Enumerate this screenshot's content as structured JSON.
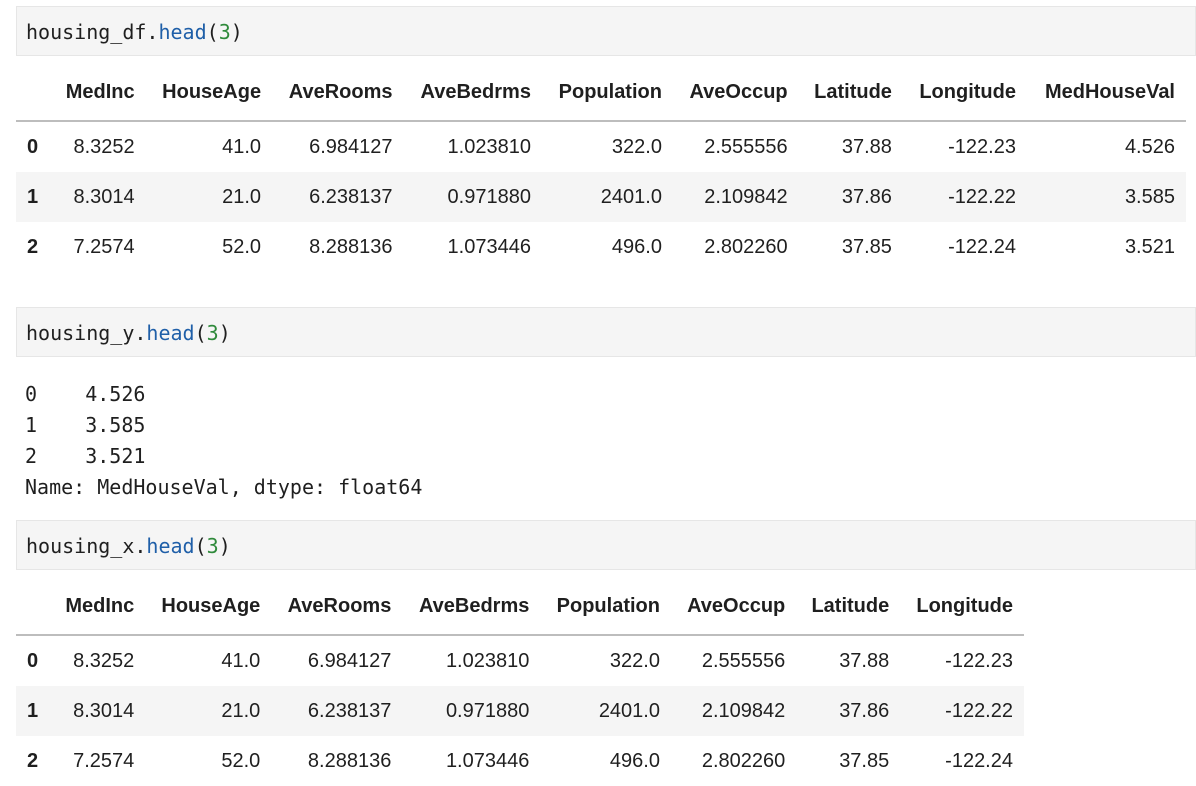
{
  "cells": [
    {
      "var": "housing_df",
      "dot": ".",
      "fn": "head",
      "open": "(",
      "arg": "3",
      "close": ")"
    },
    {
      "var": "housing_y",
      "dot": ".",
      "fn": "head",
      "open": "(",
      "arg": "3",
      "close": ")"
    },
    {
      "var": "housing_x",
      "dot": ".",
      "fn": "head",
      "open": "(",
      "arg": "3",
      "close": ")"
    }
  ],
  "df_table": {
    "columns": [
      "MedInc",
      "HouseAge",
      "AveRooms",
      "AveBedrms",
      "Population",
      "AveOccup",
      "Latitude",
      "Longitude",
      "MedHouseVal"
    ],
    "rows": [
      {
        "index": "0",
        "values": [
          "8.3252",
          "41.0",
          "6.984127",
          "1.023810",
          "322.0",
          "2.555556",
          "37.88",
          "-122.23",
          "4.526"
        ]
      },
      {
        "index": "1",
        "values": [
          "8.3014",
          "21.0",
          "6.238137",
          "0.971880",
          "2401.0",
          "2.109842",
          "37.86",
          "-122.22",
          "3.585"
        ]
      },
      {
        "index": "2",
        "values": [
          "7.2574",
          "52.0",
          "8.288136",
          "1.073446",
          "496.0",
          "2.802260",
          "37.85",
          "-122.24",
          "3.521"
        ]
      }
    ]
  },
  "y_output": {
    "lines": [
      "0    4.526",
      "1    3.585",
      "2    3.521",
      "Name: MedHouseVal, dtype: float64"
    ]
  },
  "x_table": {
    "columns": [
      "MedInc",
      "HouseAge",
      "AveRooms",
      "AveBedrms",
      "Population",
      "AveOccup",
      "Latitude",
      "Longitude"
    ],
    "rows": [
      {
        "index": "0",
        "values": [
          "8.3252",
          "41.0",
          "6.984127",
          "1.023810",
          "322.0",
          "2.555556",
          "37.88",
          "-122.23"
        ]
      },
      {
        "index": "1",
        "values": [
          "8.3014",
          "21.0",
          "6.238137",
          "0.971880",
          "2401.0",
          "2.109842",
          "37.86",
          "-122.22"
        ]
      },
      {
        "index": "2",
        "values": [
          "7.2574",
          "52.0",
          "8.288136",
          "1.073446",
          "496.0",
          "2.802260",
          "37.85",
          "-122.24"
        ]
      }
    ]
  }
}
